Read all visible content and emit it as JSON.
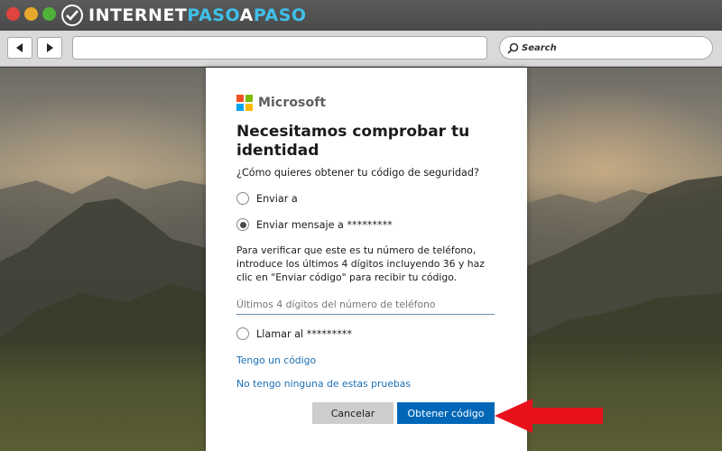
{
  "browser": {
    "brand": {
      "part1": "INTERNET",
      "part2": "PASO",
      "part3": "A",
      "part4": "PASO"
    },
    "search_placeholder": "Search"
  },
  "dialog": {
    "brand_name": "Microsoft",
    "ms_colors": [
      "#f25022",
      "#7fba00",
      "#00a4ef",
      "#ffb900"
    ],
    "heading": "Necesitamos comprobar tu identidad",
    "question": "¿Cómo quieres obtener tu código de seguridad?",
    "options": [
      {
        "label": "Enviar a",
        "selected": false
      },
      {
        "label": "Enviar mensaje a *********",
        "selected": true
      },
      {
        "label": "Llamar al *********",
        "selected": false
      }
    ],
    "explanation": "Para verificar que este es tu número de teléfono, introduce los últimos 4 dígitos incluyendo 36 y haz clic en \"Enviar código\" para recibir tu código.",
    "phone_placeholder": "Últimos 4 dígitos del número de teléfono",
    "link_have_code": "Tengo un código",
    "link_no_proofs": "No tengo ninguna de estas pruebas",
    "cancel_label": "Cancelar",
    "submit_label": "Obtener código",
    "primary_color": "#0067b8",
    "link_color": "#1a6fb5"
  },
  "annotation": {
    "arrow_color": "#e8101b"
  }
}
